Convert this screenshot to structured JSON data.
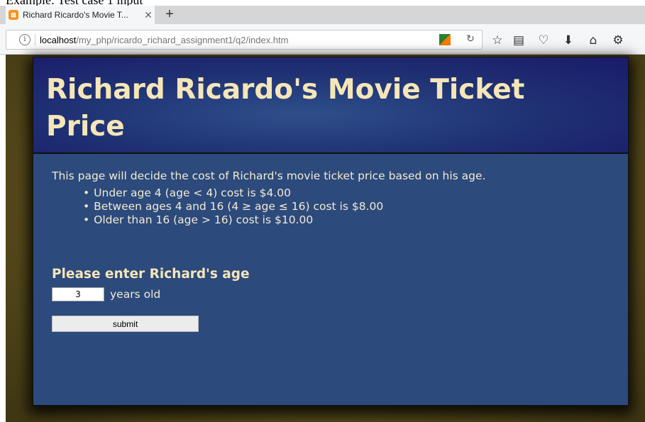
{
  "caption": "Example: Test case 1 input",
  "browser": {
    "tab_title": "Richard Ricardo's Movie T...",
    "tab_close": "✕",
    "new_tab": "+",
    "url_host": "localhost",
    "url_path": "/my_php/ricardo_richard_assignment1/q2/index.htm",
    "info_glyph": "i",
    "reload_glyph": "↻",
    "toolbar_icons": [
      "star-icon",
      "reading-list-icon",
      "pocket-icon",
      "download-icon",
      "home-icon",
      "extension-icon"
    ]
  },
  "page": {
    "title": "Richard Ricardo's Movie Ticket Price",
    "intro": "This page will decide the cost of Richard's movie ticket price based on his age.",
    "rules": [
      "Under age 4 (age < 4) cost is $4.00",
      "Between ages 4 and 16 (4 ≥ age ≤ 16) cost is $8.00",
      "Older than 16 (age > 16) cost is $10.00"
    ],
    "form_title": "Please enter Richard's age",
    "age_value": "3",
    "age_unit": "years old",
    "submit_label": "submit"
  },
  "colors": {
    "card_bg": "#2c4a7c",
    "header_bg": "#1e2f72",
    "title_text": "#f5e6b8",
    "body_text": "#f3ead2",
    "page_bg": "#5a4d1c"
  }
}
